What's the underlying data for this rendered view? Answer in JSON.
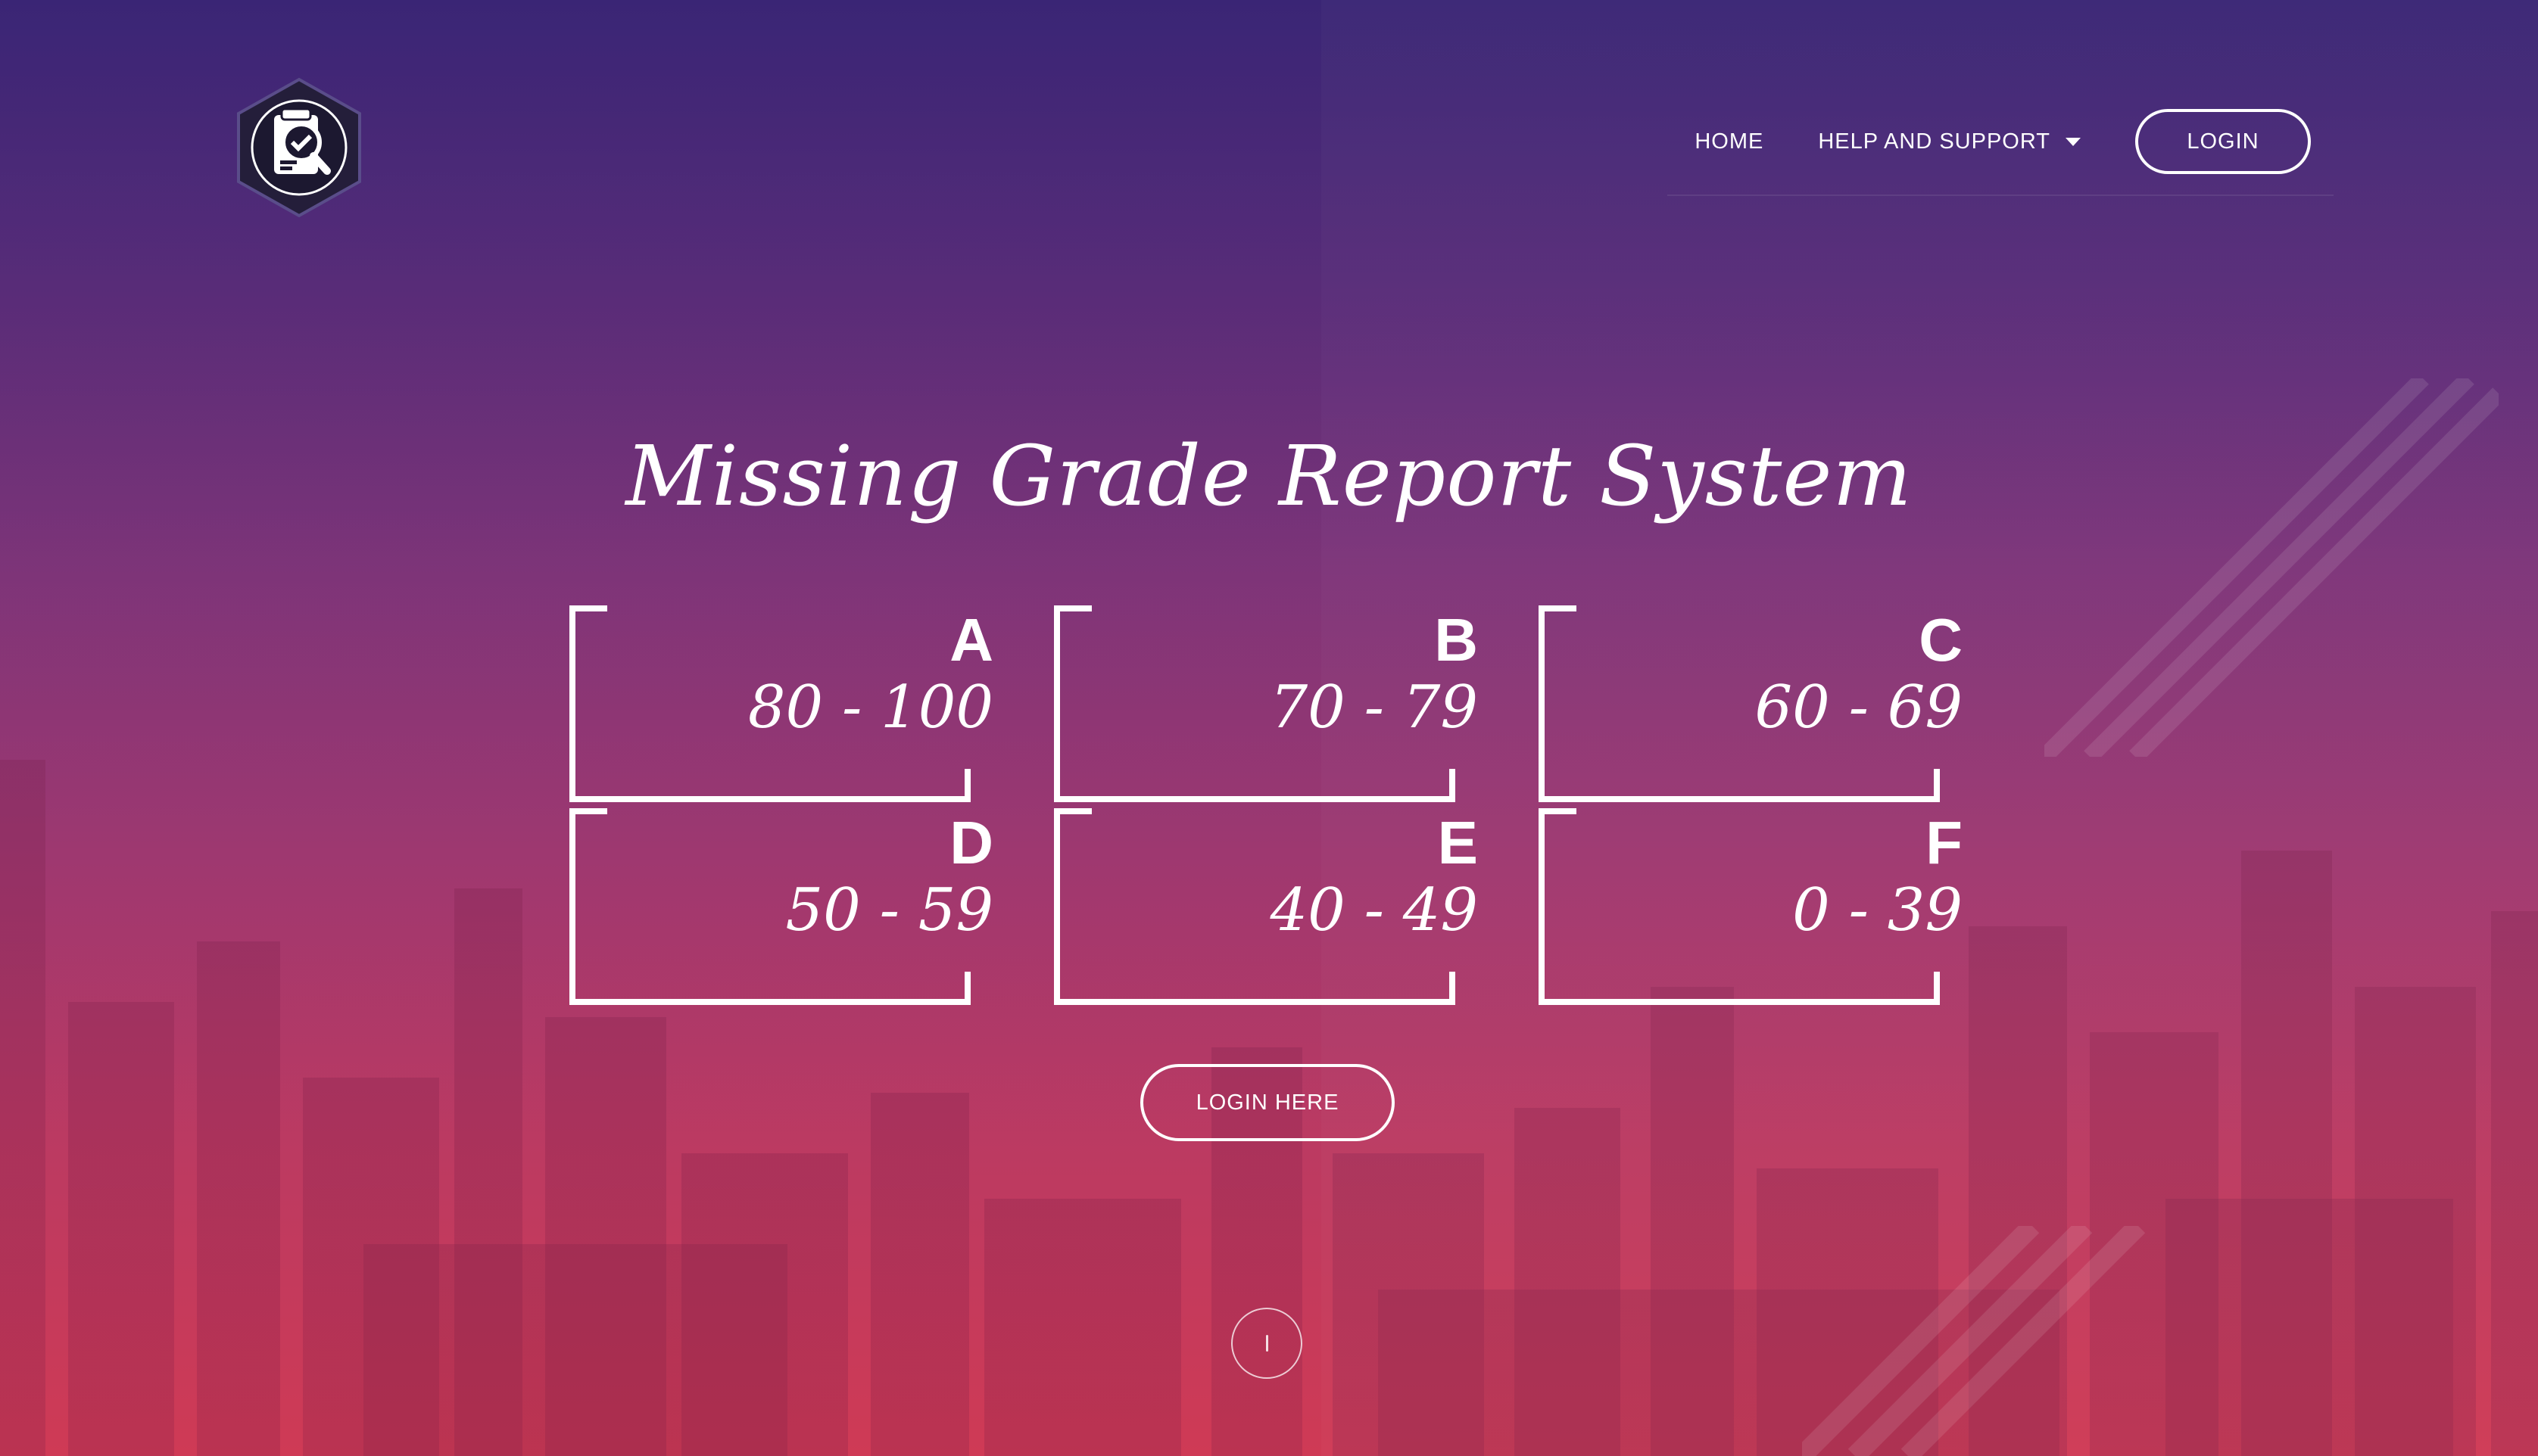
{
  "nav": {
    "home": "HOME",
    "help_support": "HELP AND SUPPORT",
    "login": "LOGIN"
  },
  "hero": {
    "title": "Missing Grade Report System",
    "login_here": "LOGIN HERE"
  },
  "grades": [
    {
      "letter": "A",
      "range": "80 - 100"
    },
    {
      "letter": "B",
      "range": "70 - 79"
    },
    {
      "letter": "C",
      "range": "60 - 69"
    },
    {
      "letter": "D",
      "range": "50 - 59"
    },
    {
      "letter": "E",
      "range": "40 - 49"
    },
    {
      "letter": "F",
      "range": "0 - 39"
    }
  ],
  "icons": {
    "logo": "report-search-logo",
    "dropdown": "caret-down-icon",
    "scroll": "scroll-down-icon"
  },
  "colors": {
    "top": "#3a2575",
    "bottom": "#d03a55",
    "text": "#ffffff"
  }
}
